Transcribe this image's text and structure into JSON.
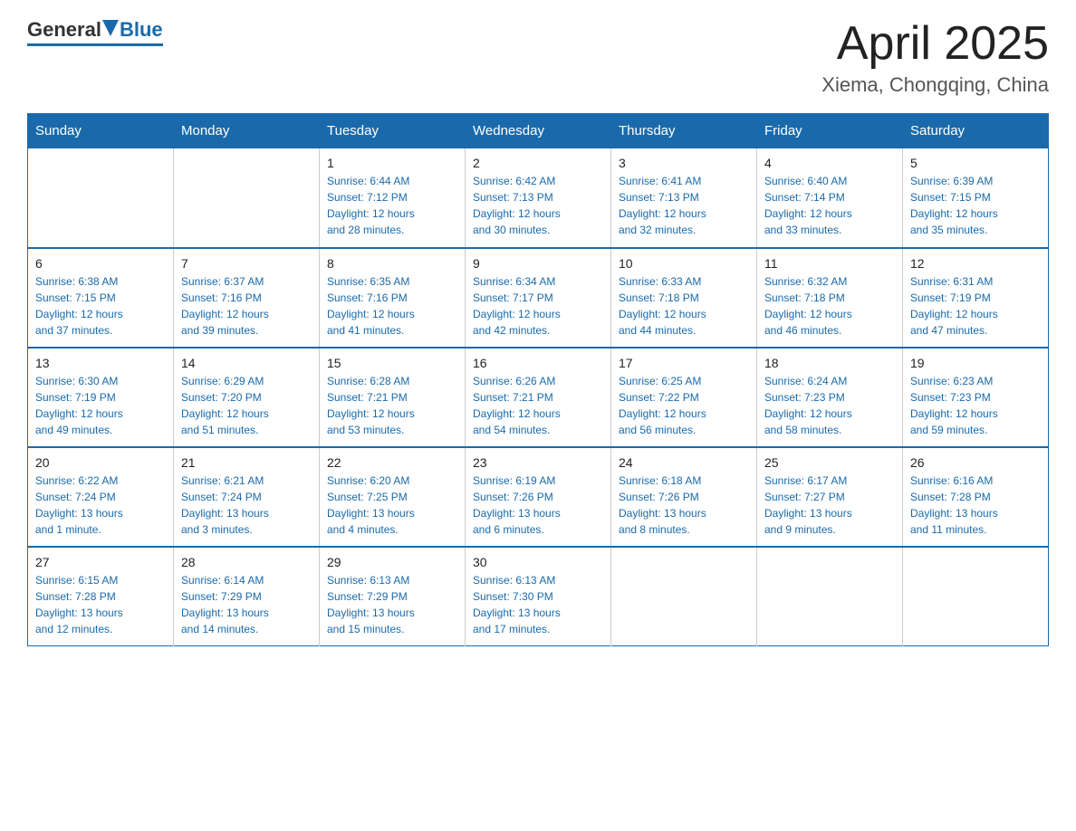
{
  "header": {
    "title": "April 2025",
    "subtitle": "Xiema, Chongqing, China",
    "logo_general": "General",
    "logo_blue": "Blue"
  },
  "days_of_week": [
    "Sunday",
    "Monday",
    "Tuesday",
    "Wednesday",
    "Thursday",
    "Friday",
    "Saturday"
  ],
  "weeks": [
    [
      {
        "num": "",
        "info": ""
      },
      {
        "num": "",
        "info": ""
      },
      {
        "num": "1",
        "info": "Sunrise: 6:44 AM\nSunset: 7:12 PM\nDaylight: 12 hours\nand 28 minutes."
      },
      {
        "num": "2",
        "info": "Sunrise: 6:42 AM\nSunset: 7:13 PM\nDaylight: 12 hours\nand 30 minutes."
      },
      {
        "num": "3",
        "info": "Sunrise: 6:41 AM\nSunset: 7:13 PM\nDaylight: 12 hours\nand 32 minutes."
      },
      {
        "num": "4",
        "info": "Sunrise: 6:40 AM\nSunset: 7:14 PM\nDaylight: 12 hours\nand 33 minutes."
      },
      {
        "num": "5",
        "info": "Sunrise: 6:39 AM\nSunset: 7:15 PM\nDaylight: 12 hours\nand 35 minutes."
      }
    ],
    [
      {
        "num": "6",
        "info": "Sunrise: 6:38 AM\nSunset: 7:15 PM\nDaylight: 12 hours\nand 37 minutes."
      },
      {
        "num": "7",
        "info": "Sunrise: 6:37 AM\nSunset: 7:16 PM\nDaylight: 12 hours\nand 39 minutes."
      },
      {
        "num": "8",
        "info": "Sunrise: 6:35 AM\nSunset: 7:16 PM\nDaylight: 12 hours\nand 41 minutes."
      },
      {
        "num": "9",
        "info": "Sunrise: 6:34 AM\nSunset: 7:17 PM\nDaylight: 12 hours\nand 42 minutes."
      },
      {
        "num": "10",
        "info": "Sunrise: 6:33 AM\nSunset: 7:18 PM\nDaylight: 12 hours\nand 44 minutes."
      },
      {
        "num": "11",
        "info": "Sunrise: 6:32 AM\nSunset: 7:18 PM\nDaylight: 12 hours\nand 46 minutes."
      },
      {
        "num": "12",
        "info": "Sunrise: 6:31 AM\nSunset: 7:19 PM\nDaylight: 12 hours\nand 47 minutes."
      }
    ],
    [
      {
        "num": "13",
        "info": "Sunrise: 6:30 AM\nSunset: 7:19 PM\nDaylight: 12 hours\nand 49 minutes."
      },
      {
        "num": "14",
        "info": "Sunrise: 6:29 AM\nSunset: 7:20 PM\nDaylight: 12 hours\nand 51 minutes."
      },
      {
        "num": "15",
        "info": "Sunrise: 6:28 AM\nSunset: 7:21 PM\nDaylight: 12 hours\nand 53 minutes."
      },
      {
        "num": "16",
        "info": "Sunrise: 6:26 AM\nSunset: 7:21 PM\nDaylight: 12 hours\nand 54 minutes."
      },
      {
        "num": "17",
        "info": "Sunrise: 6:25 AM\nSunset: 7:22 PM\nDaylight: 12 hours\nand 56 minutes."
      },
      {
        "num": "18",
        "info": "Sunrise: 6:24 AM\nSunset: 7:23 PM\nDaylight: 12 hours\nand 58 minutes."
      },
      {
        "num": "19",
        "info": "Sunrise: 6:23 AM\nSunset: 7:23 PM\nDaylight: 12 hours\nand 59 minutes."
      }
    ],
    [
      {
        "num": "20",
        "info": "Sunrise: 6:22 AM\nSunset: 7:24 PM\nDaylight: 13 hours\nand 1 minute."
      },
      {
        "num": "21",
        "info": "Sunrise: 6:21 AM\nSunset: 7:24 PM\nDaylight: 13 hours\nand 3 minutes."
      },
      {
        "num": "22",
        "info": "Sunrise: 6:20 AM\nSunset: 7:25 PM\nDaylight: 13 hours\nand 4 minutes."
      },
      {
        "num": "23",
        "info": "Sunrise: 6:19 AM\nSunset: 7:26 PM\nDaylight: 13 hours\nand 6 minutes."
      },
      {
        "num": "24",
        "info": "Sunrise: 6:18 AM\nSunset: 7:26 PM\nDaylight: 13 hours\nand 8 minutes."
      },
      {
        "num": "25",
        "info": "Sunrise: 6:17 AM\nSunset: 7:27 PM\nDaylight: 13 hours\nand 9 minutes."
      },
      {
        "num": "26",
        "info": "Sunrise: 6:16 AM\nSunset: 7:28 PM\nDaylight: 13 hours\nand 11 minutes."
      }
    ],
    [
      {
        "num": "27",
        "info": "Sunrise: 6:15 AM\nSunset: 7:28 PM\nDaylight: 13 hours\nand 12 minutes."
      },
      {
        "num": "28",
        "info": "Sunrise: 6:14 AM\nSunset: 7:29 PM\nDaylight: 13 hours\nand 14 minutes."
      },
      {
        "num": "29",
        "info": "Sunrise: 6:13 AM\nSunset: 7:29 PM\nDaylight: 13 hours\nand 15 minutes."
      },
      {
        "num": "30",
        "info": "Sunrise: 6:13 AM\nSunset: 7:30 PM\nDaylight: 13 hours\nand 17 minutes."
      },
      {
        "num": "",
        "info": ""
      },
      {
        "num": "",
        "info": ""
      },
      {
        "num": "",
        "info": ""
      }
    ]
  ]
}
